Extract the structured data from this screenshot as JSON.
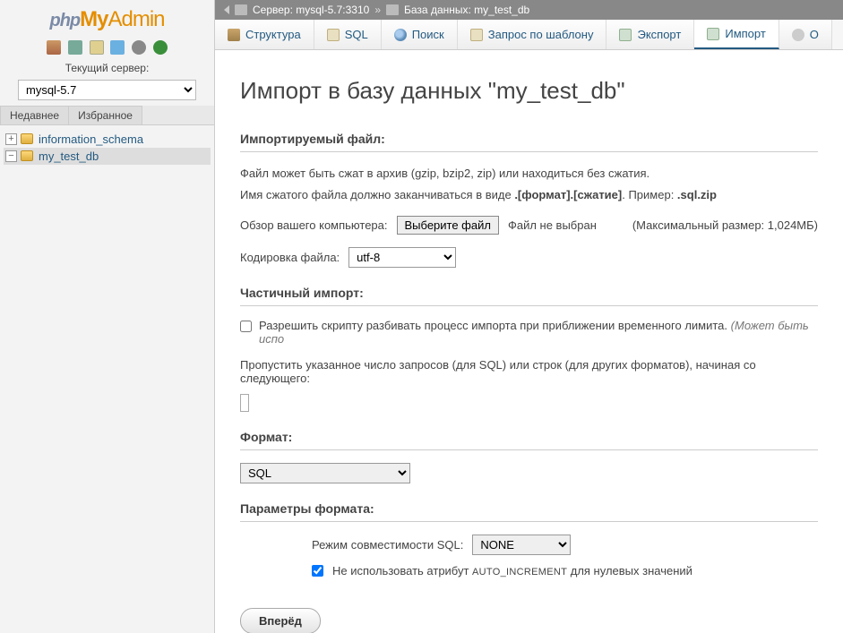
{
  "logo": {
    "php": "php",
    "my": "My",
    "admin": "Admin"
  },
  "sidebar": {
    "server_label": "Текущий сервер:",
    "server_value": "mysql-5.7",
    "recent_tab": "Недавнее",
    "favorites_tab": "Избранное",
    "databases": [
      {
        "name": "information_schema",
        "expanded": false,
        "selected": false
      },
      {
        "name": "my_test_db",
        "expanded": false,
        "selected": true
      }
    ]
  },
  "breadcrumb": {
    "server_label": "Сервер:",
    "server_value": "mysql-5.7:3310",
    "db_label": "База данных:",
    "db_value": "my_test_db"
  },
  "tabs": [
    {
      "key": "structure",
      "label": "Структура"
    },
    {
      "key": "sql",
      "label": "SQL"
    },
    {
      "key": "search",
      "label": "Поиск"
    },
    {
      "key": "query",
      "label": "Запрос по шаблону"
    },
    {
      "key": "export",
      "label": "Экспорт"
    },
    {
      "key": "import",
      "label": "Импорт"
    },
    {
      "key": "operations",
      "label": "О"
    }
  ],
  "page": {
    "title": "Импорт в базу данных \"my_test_db\"",
    "file_section": "Импортируемый файл:",
    "hint1": "Файл может быть сжат в архив (gzip, bzip2, zip) или находиться без сжатия.",
    "hint2_a": "Имя сжатого файла должно заканчиваться в виде ",
    "hint2_b": ".[формат].[сжатие]",
    "hint2_c": ". Пример: ",
    "hint2_d": ".sql.zip",
    "browse_label": "Обзор вашего компьютера:",
    "choose_file_btn": "Выберите файл",
    "no_file": "Файл не выбран",
    "max_size": "(Максимальный размер: 1,024МБ)",
    "charset_label": "Кодировка файла:",
    "charset_value": "utf-8",
    "partial_section": "Частичный импорт:",
    "partial_checkbox": "Разрешить скрипту разбивать процесс импорта при приближении временного лимита.",
    "partial_hint": "(Может быть испо",
    "skip_label": "Пропустить указанное число запросов (для SQL) или строк (для других форматов), начиная со следующего:",
    "format_section": "Формат:",
    "format_value": "SQL",
    "format_options_section": "Параметры формата:",
    "compat_label": "Режим совместимости SQL:",
    "compat_value": "NONE",
    "no_autoinc_a": "Не использовать атрибут ",
    "no_autoinc_b": "AUTO_INCREMENT",
    "no_autoinc_c": " для нулевых значений",
    "submit": "Вперёд"
  }
}
